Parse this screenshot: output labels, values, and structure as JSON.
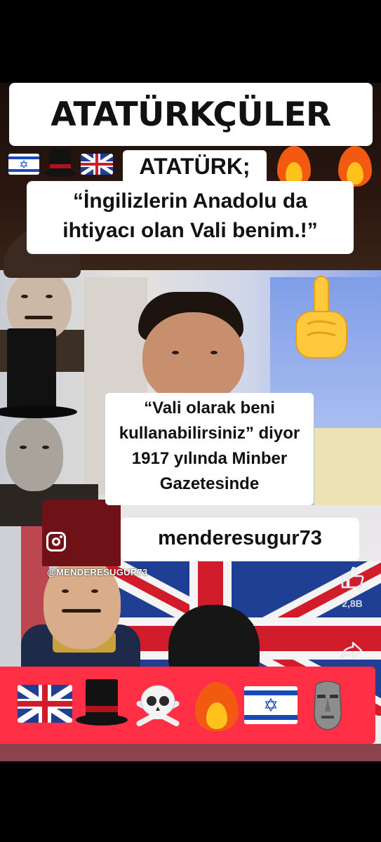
{
  "title": "ATATÜRKÇÜLER",
  "subtitle": {
    "heading": "ATATÜRK;",
    "quote_line1": "“İngilizlerin Anadolu da",
    "quote_line2": "ihtiyacı olan Vali benim.!”"
  },
  "quote": {
    "line1": "“Vali olarak beni",
    "line2": "kullanabilirsiniz” diyor",
    "line3": "1917 yılında Minber",
    "line4": "Gazetesinde"
  },
  "instagram": {
    "username": "menderesugur73",
    "watermark": "@MENDERESUGUR73",
    "icon": "instagram-icon"
  },
  "actions": {
    "like_count": "2,8B",
    "like_icon": "thumbs-up-icon",
    "share_icon": "share-arrow-icon"
  },
  "top_emoji_row": [
    "israel-flag",
    "top-hat",
    "uk-flag",
    "fire",
    "fire"
  ],
  "bottom_emoji_row": [
    "uk-flag",
    "top-hat",
    "skull-and-crossbones",
    "fire",
    "israel-flag",
    "moai"
  ],
  "colors": {
    "accent_red": "#ff2f45",
    "text_dark": "#111111",
    "box_white": "#ffffff"
  }
}
